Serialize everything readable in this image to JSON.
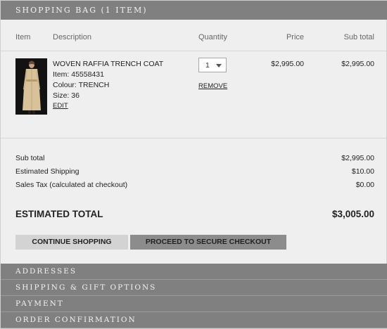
{
  "bag_header": {
    "title": "Shopping Bag (1 item)"
  },
  "columns": {
    "item": "Item",
    "description": "Description",
    "quantity": "Quantity",
    "price": "Price",
    "subtotal": "Sub total"
  },
  "line_item": {
    "name": "WOVEN RAFFIA TRENCH COAT",
    "item_no": "Item: 45558431",
    "colour": "Colour: TRENCH",
    "size": "Size: 36",
    "edit_label": "Edit",
    "quantity": "1",
    "remove_label": "Remove",
    "price": "$2,995.00",
    "subtotal": "$2,995.00"
  },
  "summary": {
    "subtotal_label": "Sub total",
    "subtotal_value": "$2,995.00",
    "shipping_label": "Estimated Shipping",
    "shipping_value": "$10.00",
    "tax_label": "Sales Tax (calculated at checkout)",
    "tax_value": "$0.00",
    "total_label": "Estimated Total",
    "total_value": "$3,005.00"
  },
  "buttons": {
    "continue": "Continue Shopping",
    "checkout": "Proceed to Secure Checkout"
  },
  "steps": [
    "Addresses",
    "Shipping & Gift Options",
    "Payment",
    "Order Confirmation"
  ],
  "colors": {
    "header_bg": "#808080",
    "panel_bg": "#efefef",
    "continue_bg": "#d3d3d3",
    "checkout_bg": "#8c8c8c"
  }
}
